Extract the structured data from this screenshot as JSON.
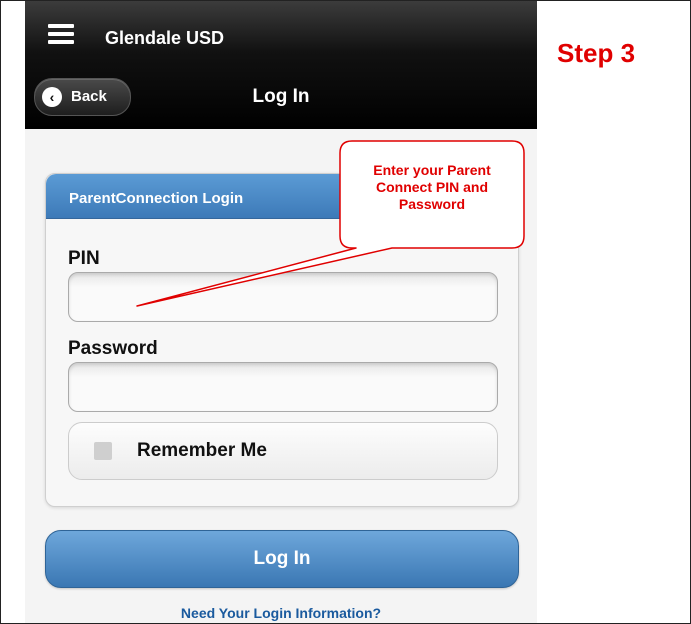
{
  "header": {
    "app_title": "Glendale USD",
    "back_label": "Back",
    "page_title": "Log In"
  },
  "login_card": {
    "title": "ParentConnection Login",
    "pin_label": "PIN",
    "pin_value": "",
    "password_label": "Password",
    "password_value": "",
    "remember_label": "Remember Me",
    "remember_checked": false
  },
  "actions": {
    "login_label": "Log In",
    "help_link": "Need Your Login Information?"
  },
  "annotation": {
    "step": "Step 3",
    "callout_lines": [
      "Enter your Parent",
      "Connect PIN and",
      "Password"
    ],
    "color": "#e00000"
  },
  "colors": {
    "accent_blue": "#3d7ab8",
    "header_black": "#000000"
  }
}
